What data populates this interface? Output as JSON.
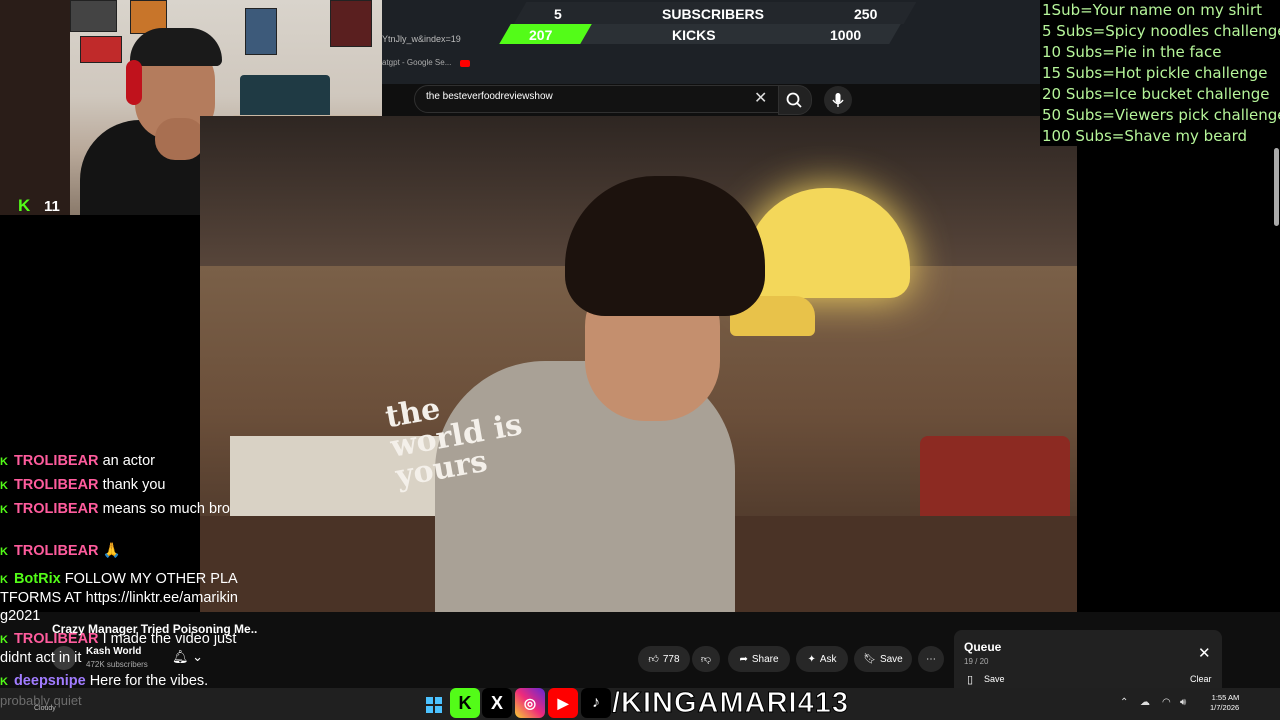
{
  "goal": {
    "current_subs": "5",
    "label_subs": "SUBSCRIBERS",
    "target_subs": "250",
    "current_kicks": "207",
    "label_kicks": "KICKS",
    "target_kicks": "1000",
    "kicks_progress": 0.207
  },
  "browser": {
    "url_fragment": "YtnJly_w&index=19",
    "bookmark_fragment": "atgpt - Google Se..."
  },
  "webcam": {
    "kick_viewers": "11"
  },
  "youtube": {
    "search_value": "the besteverfoodreviewshow",
    "video_title": "Crazy Manager Tried Poisoning Me..",
    "channel_name": "Kash World",
    "channel_subs": "472K subscribers",
    "likes": "778",
    "share_label": "Share",
    "ask_label": "Ask",
    "save_label": "Save",
    "hoodie_text": "the world is yours"
  },
  "queue": {
    "title": "Queue",
    "count": "19 / 20",
    "save_label": "Save",
    "clear_label": "Clear"
  },
  "challenges": [
    "1Sub=Your name on my shirt",
    "5 Subs=Spicy noodles challenge",
    "10 Subs=Pie in the face",
    "15 Subs=Hot pickle challenge",
    "20 Subs=Ice bucket challenge",
    "50 Subs=Viewers pick challenge",
    "100 Subs=Shave my beard"
  ],
  "chat": [
    {
      "user": "TROLIBEAR",
      "msg": "an actor"
    },
    {
      "user": "TROLIBEAR",
      "msg": "thank you"
    },
    {
      "user": "TROLIBEAR",
      "msg": "means so much bro"
    },
    {
      "user": "TROLIBEAR",
      "msg": "🙏"
    },
    {
      "user": "BotRix",
      "msg": "FOLLOW MY OTHER PLATFORMS AT https://linktr.ee/amariking2021"
    },
    {
      "user": "TROLIBEAR",
      "msg": "I made the video just didnt act in it"
    },
    {
      "user": "deepsnipe",
      "msg": "Here for the vibes."
    }
  ],
  "overlay": {
    "handle": "/KINGAMARI413"
  },
  "taskbar": {
    "status_fragment": "probably quiet",
    "weather": "Cloudy",
    "time": "1:55 AM",
    "date": "1/7/2026"
  },
  "colors": {
    "kick_green": "#53fc18",
    "challenge_text": "#b6f59a",
    "chat_user": "#ff5c9d"
  }
}
